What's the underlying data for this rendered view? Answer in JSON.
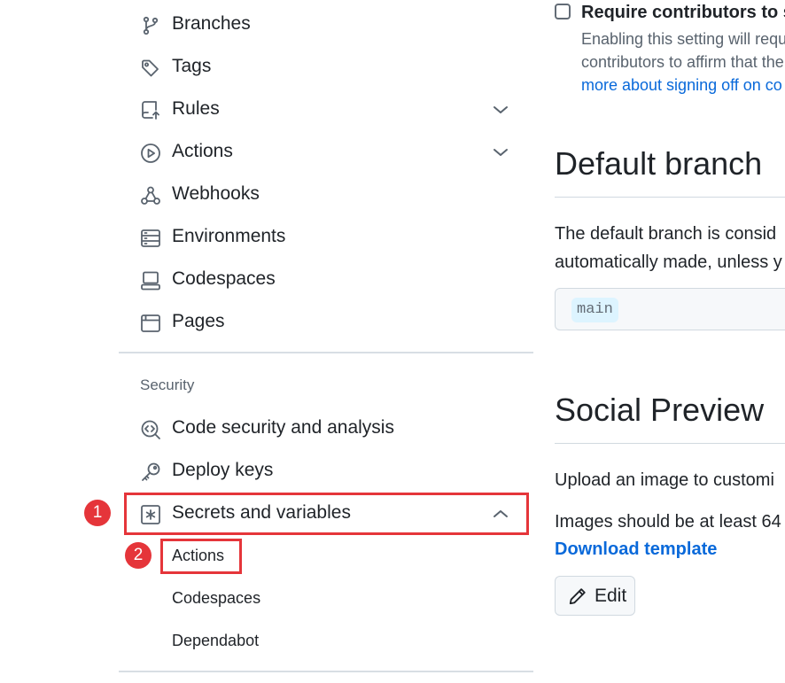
{
  "sidebar": {
    "items": [
      {
        "label": "Branches",
        "icon": "git-branch-icon"
      },
      {
        "label": "Tags",
        "icon": "tag-icon"
      },
      {
        "label": "Rules",
        "icon": "repo-push-icon",
        "expandable": true
      },
      {
        "label": "Actions",
        "icon": "play-icon",
        "expandable": true
      },
      {
        "label": "Webhooks",
        "icon": "webhook-icon"
      },
      {
        "label": "Environments",
        "icon": "server-icon"
      },
      {
        "label": "Codespaces",
        "icon": "codespaces-icon"
      },
      {
        "label": "Pages",
        "icon": "browser-icon"
      }
    ],
    "security_heading": "Security",
    "security_items": [
      {
        "label": "Code security and analysis",
        "icon": "codescan-icon"
      },
      {
        "label": "Deploy keys",
        "icon": "key-icon"
      },
      {
        "label": "Secrets and variables",
        "icon": "asterisk-icon",
        "expanded": true
      }
    ],
    "secrets_subitems": [
      "Actions",
      "Codespaces",
      "Dependabot"
    ]
  },
  "annotations": {
    "step1": "1",
    "step2": "2",
    "highlight_color": "#e5353a"
  },
  "main": {
    "checkbox_label": "Require contributors to s",
    "checkbox_checked": false,
    "checkbox_note_line1": "Enabling this setting will requ",
    "checkbox_note_line2": "contributors to affirm that the",
    "checkbox_note_link": "more about signing off on co",
    "default_branch_title": "Default branch",
    "default_branch_text_line1": "The default branch is consid",
    "default_branch_text_line2": "automatically made, unless y",
    "default_branch_value": "main",
    "social_preview_title": "Social Preview",
    "social_preview_text": "Upload an image to customi",
    "social_preview_size_text": "Images should be at least 64",
    "download_template_link": "Download template",
    "edit_button": "Edit"
  },
  "colors": {
    "text": "#1f2328",
    "muted": "#59636e",
    "link": "#0969da",
    "branch_pill_bg": "#ddf4ff"
  }
}
